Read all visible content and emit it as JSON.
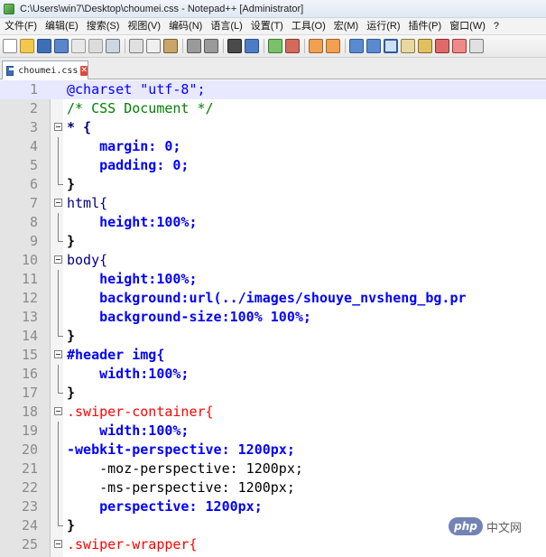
{
  "window": {
    "title": "C:\\Users\\win7\\Desktop\\choumei.css - Notepad++ [Administrator]"
  },
  "menu": {
    "items": [
      "文件(F)",
      "编辑(E)",
      "搜索(S)",
      "视图(V)",
      "编码(N)",
      "语言(L)",
      "设置(T)",
      "工具(O)",
      "宏(M)",
      "运行(R)",
      "插件(P)",
      "窗口(W)",
      "?"
    ]
  },
  "toolbar": {
    "icons": [
      "new-file-icon",
      "open-file-icon",
      "save-icon",
      "save-all-icon",
      "close-icon",
      "close-all-icon",
      "print-icon",
      "cut-icon",
      "copy-icon",
      "paste-icon",
      "undo-icon",
      "redo-icon",
      "find-icon",
      "replace-icon",
      "zoom-in-icon",
      "zoom-out-icon",
      "sync-vertical-icon",
      "sync-horizontal-icon",
      "word-wrap-icon",
      "show-all-chars-icon",
      "indent-guide-icon",
      "doc-map-icon",
      "function-list-icon",
      "folder-workspace-icon",
      "monitoring-icon",
      "record-macro-icon"
    ]
  },
  "tab": {
    "label": "choumei.css",
    "close": "✕"
  },
  "editor": {
    "lines": [
      {
        "n": "1",
        "text": "@charset \"utf-8\";"
      },
      {
        "n": "2",
        "text": "/* CSS Document */"
      },
      {
        "n": "3",
        "text": "* {"
      },
      {
        "n": "4",
        "text": "    margin: 0;"
      },
      {
        "n": "5",
        "text": "    padding: 0;"
      },
      {
        "n": "6",
        "text": "}"
      },
      {
        "n": "7",
        "text": "html{"
      },
      {
        "n": "8",
        "text": "    height:100%;"
      },
      {
        "n": "9",
        "text": "}"
      },
      {
        "n": "10",
        "text": "body{"
      },
      {
        "n": "11",
        "text": "    height:100%;"
      },
      {
        "n": "12",
        "text": "    background:url(../images/shouye_nvsheng_bg.pr"
      },
      {
        "n": "13",
        "text": "    background-size:100% 100%;"
      },
      {
        "n": "14",
        "text": "}"
      },
      {
        "n": "15",
        "text": "#header img{"
      },
      {
        "n": "16",
        "text": "    width:100%;"
      },
      {
        "n": "17",
        "text": "}"
      },
      {
        "n": "18",
        "text": ".swiper-container{"
      },
      {
        "n": "19",
        "text": "    width:100%;"
      },
      {
        "n": "20",
        "text": "-webkit-perspective: 1200px;"
      },
      {
        "n": "21",
        "text": "    -moz-perspective: 1200px;"
      },
      {
        "n": "22",
        "text": "    -ms-perspective: 1200px;"
      },
      {
        "n": "23",
        "text": "    perspective: 1200px;"
      },
      {
        "n": "24",
        "text": "}"
      },
      {
        "n": "25",
        "text": ".swiper-wrapper{"
      }
    ]
  },
  "watermark": {
    "logo": "php",
    "text": "中文网"
  }
}
